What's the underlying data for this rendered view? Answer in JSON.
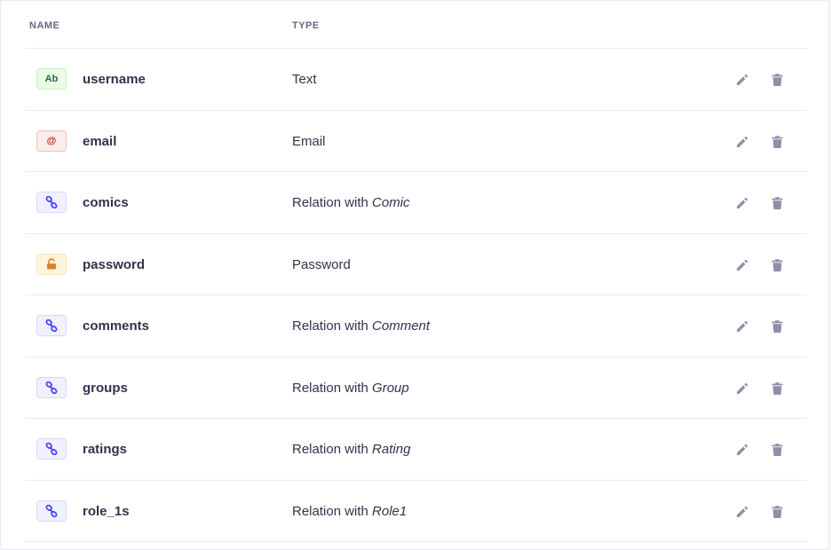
{
  "headers": {
    "name": "NAME",
    "type": "TYPE"
  },
  "colors": {
    "text": "#32324d",
    "muted": "#666687",
    "icon_action": "#8e8ea9",
    "border": "#eaeaef"
  },
  "rows": [
    {
      "name": "username",
      "type_text": "Text",
      "type_prefix": "",
      "type_target": "",
      "icon": "text-icon",
      "icon_label": "Ab",
      "badge": {
        "bg": "#eafbe7",
        "border": "#c6f0c2",
        "fg": "#2f6846"
      }
    },
    {
      "name": "email",
      "type_text": "Email",
      "type_prefix": "",
      "type_target": "",
      "icon": "at-sign-icon",
      "icon_label": "@",
      "badge": {
        "bg": "#fcecea",
        "border": "#f5c0b8",
        "fg": "#b72b1a"
      }
    },
    {
      "name": "comics",
      "type_text": "",
      "type_prefix": "Relation with ",
      "type_target": "Comic",
      "icon": "link-icon",
      "icon_label": "",
      "badge": {
        "bg": "#f0f0ff",
        "border": "#d9d8ff",
        "fg": "#4945ff"
      }
    },
    {
      "name": "password",
      "type_text": "Password",
      "type_prefix": "",
      "type_target": "",
      "icon": "lock-icon",
      "icon_label": "",
      "badge": {
        "bg": "#fdf4dc",
        "border": "#fae7b9",
        "fg": "#d9822f"
      }
    },
    {
      "name": "comments",
      "type_text": "",
      "type_prefix": "Relation with ",
      "type_target": "Comment",
      "icon": "link-icon",
      "icon_label": "",
      "badge": {
        "bg": "#f0f0ff",
        "border": "#d9d8ff",
        "fg": "#4945ff"
      }
    },
    {
      "name": "groups",
      "type_text": "",
      "type_prefix": "Relation with ",
      "type_target": "Group",
      "icon": "link-icon",
      "icon_label": "",
      "badge": {
        "bg": "#f0f0ff",
        "border": "#d9d8ff",
        "fg": "#4945ff"
      }
    },
    {
      "name": "ratings",
      "type_text": "",
      "type_prefix": "Relation with ",
      "type_target": "Rating",
      "icon": "link-icon",
      "icon_label": "",
      "badge": {
        "bg": "#f0f0ff",
        "border": "#d9d8ff",
        "fg": "#4945ff"
      }
    },
    {
      "name": "role_1s",
      "type_text": "",
      "type_prefix": "Relation with ",
      "type_target": "Role1",
      "icon": "link-icon",
      "icon_label": "",
      "badge": {
        "bg": "#f0f0ff",
        "border": "#d9d8ff",
        "fg": "#4945ff"
      }
    }
  ]
}
